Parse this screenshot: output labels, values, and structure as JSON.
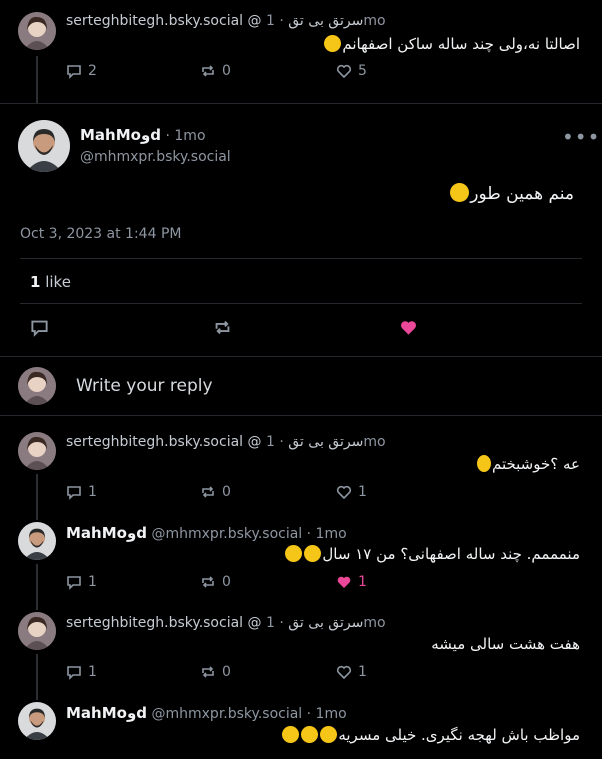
{
  "posts_top": {
    "author_handle": "serteghbitegh.bsky.social",
    "author_name": "@ سرتق بی تق",
    "time": "· 1mo",
    "text": "اصالتا نه،ولی چند ساله ساکن اصفهانم",
    "replies": "2",
    "reposts": "0",
    "likes": "5"
  },
  "focus_post": {
    "author_name": "MahMoوd",
    "time": "· 1mo",
    "handle": "@mhmxpr.bsky.social",
    "text": "منم همین طور",
    "timestamp": "Oct 3, 2023 at 1:44 PM",
    "like_count": "1",
    "like_label": "like",
    "more_label": "•••"
  },
  "composer": {
    "placeholder": "Write your reply"
  },
  "replies": [
    {
      "handle": "serteghbitegh.bsky.social",
      "name": "@ سرتق بی تق",
      "time": "· 1mo",
      "text": "عه ؟خوشبختم",
      "replies": "1",
      "reposts": "0",
      "likes": "1"
    },
    {
      "name": "MahMoوd",
      "handle": "@mhmxpr.bsky.social",
      "time": "· 1mo",
      "text": "منمممم. چند ساله اصفهانی؟  من ۱۷ سال",
      "replies": "1",
      "reposts": "0",
      "likes": "1"
    },
    {
      "handle": "serteghbitegh.bsky.social",
      "name": "@ سرتق بی تق",
      "time": "· 1mo",
      "text": "هفت هشت سالی میشه",
      "replies": "1",
      "reposts": "0",
      "likes": "1"
    },
    {
      "name": "MahMoوd",
      "handle": "@mhmxpr.bsky.social",
      "time": "· 1mo",
      "text": "مواظب باش لهجه نگیری. خیلی مسریه"
    }
  ],
  "colors": {
    "background": "#000000",
    "text": "#f1f3f5",
    "muted": "#8d96a1",
    "accent_like": "#ec4899",
    "divider": "#25282c"
  },
  "icons": [
    "reply-icon",
    "repost-icon",
    "heart-icon",
    "more-icon"
  ]
}
